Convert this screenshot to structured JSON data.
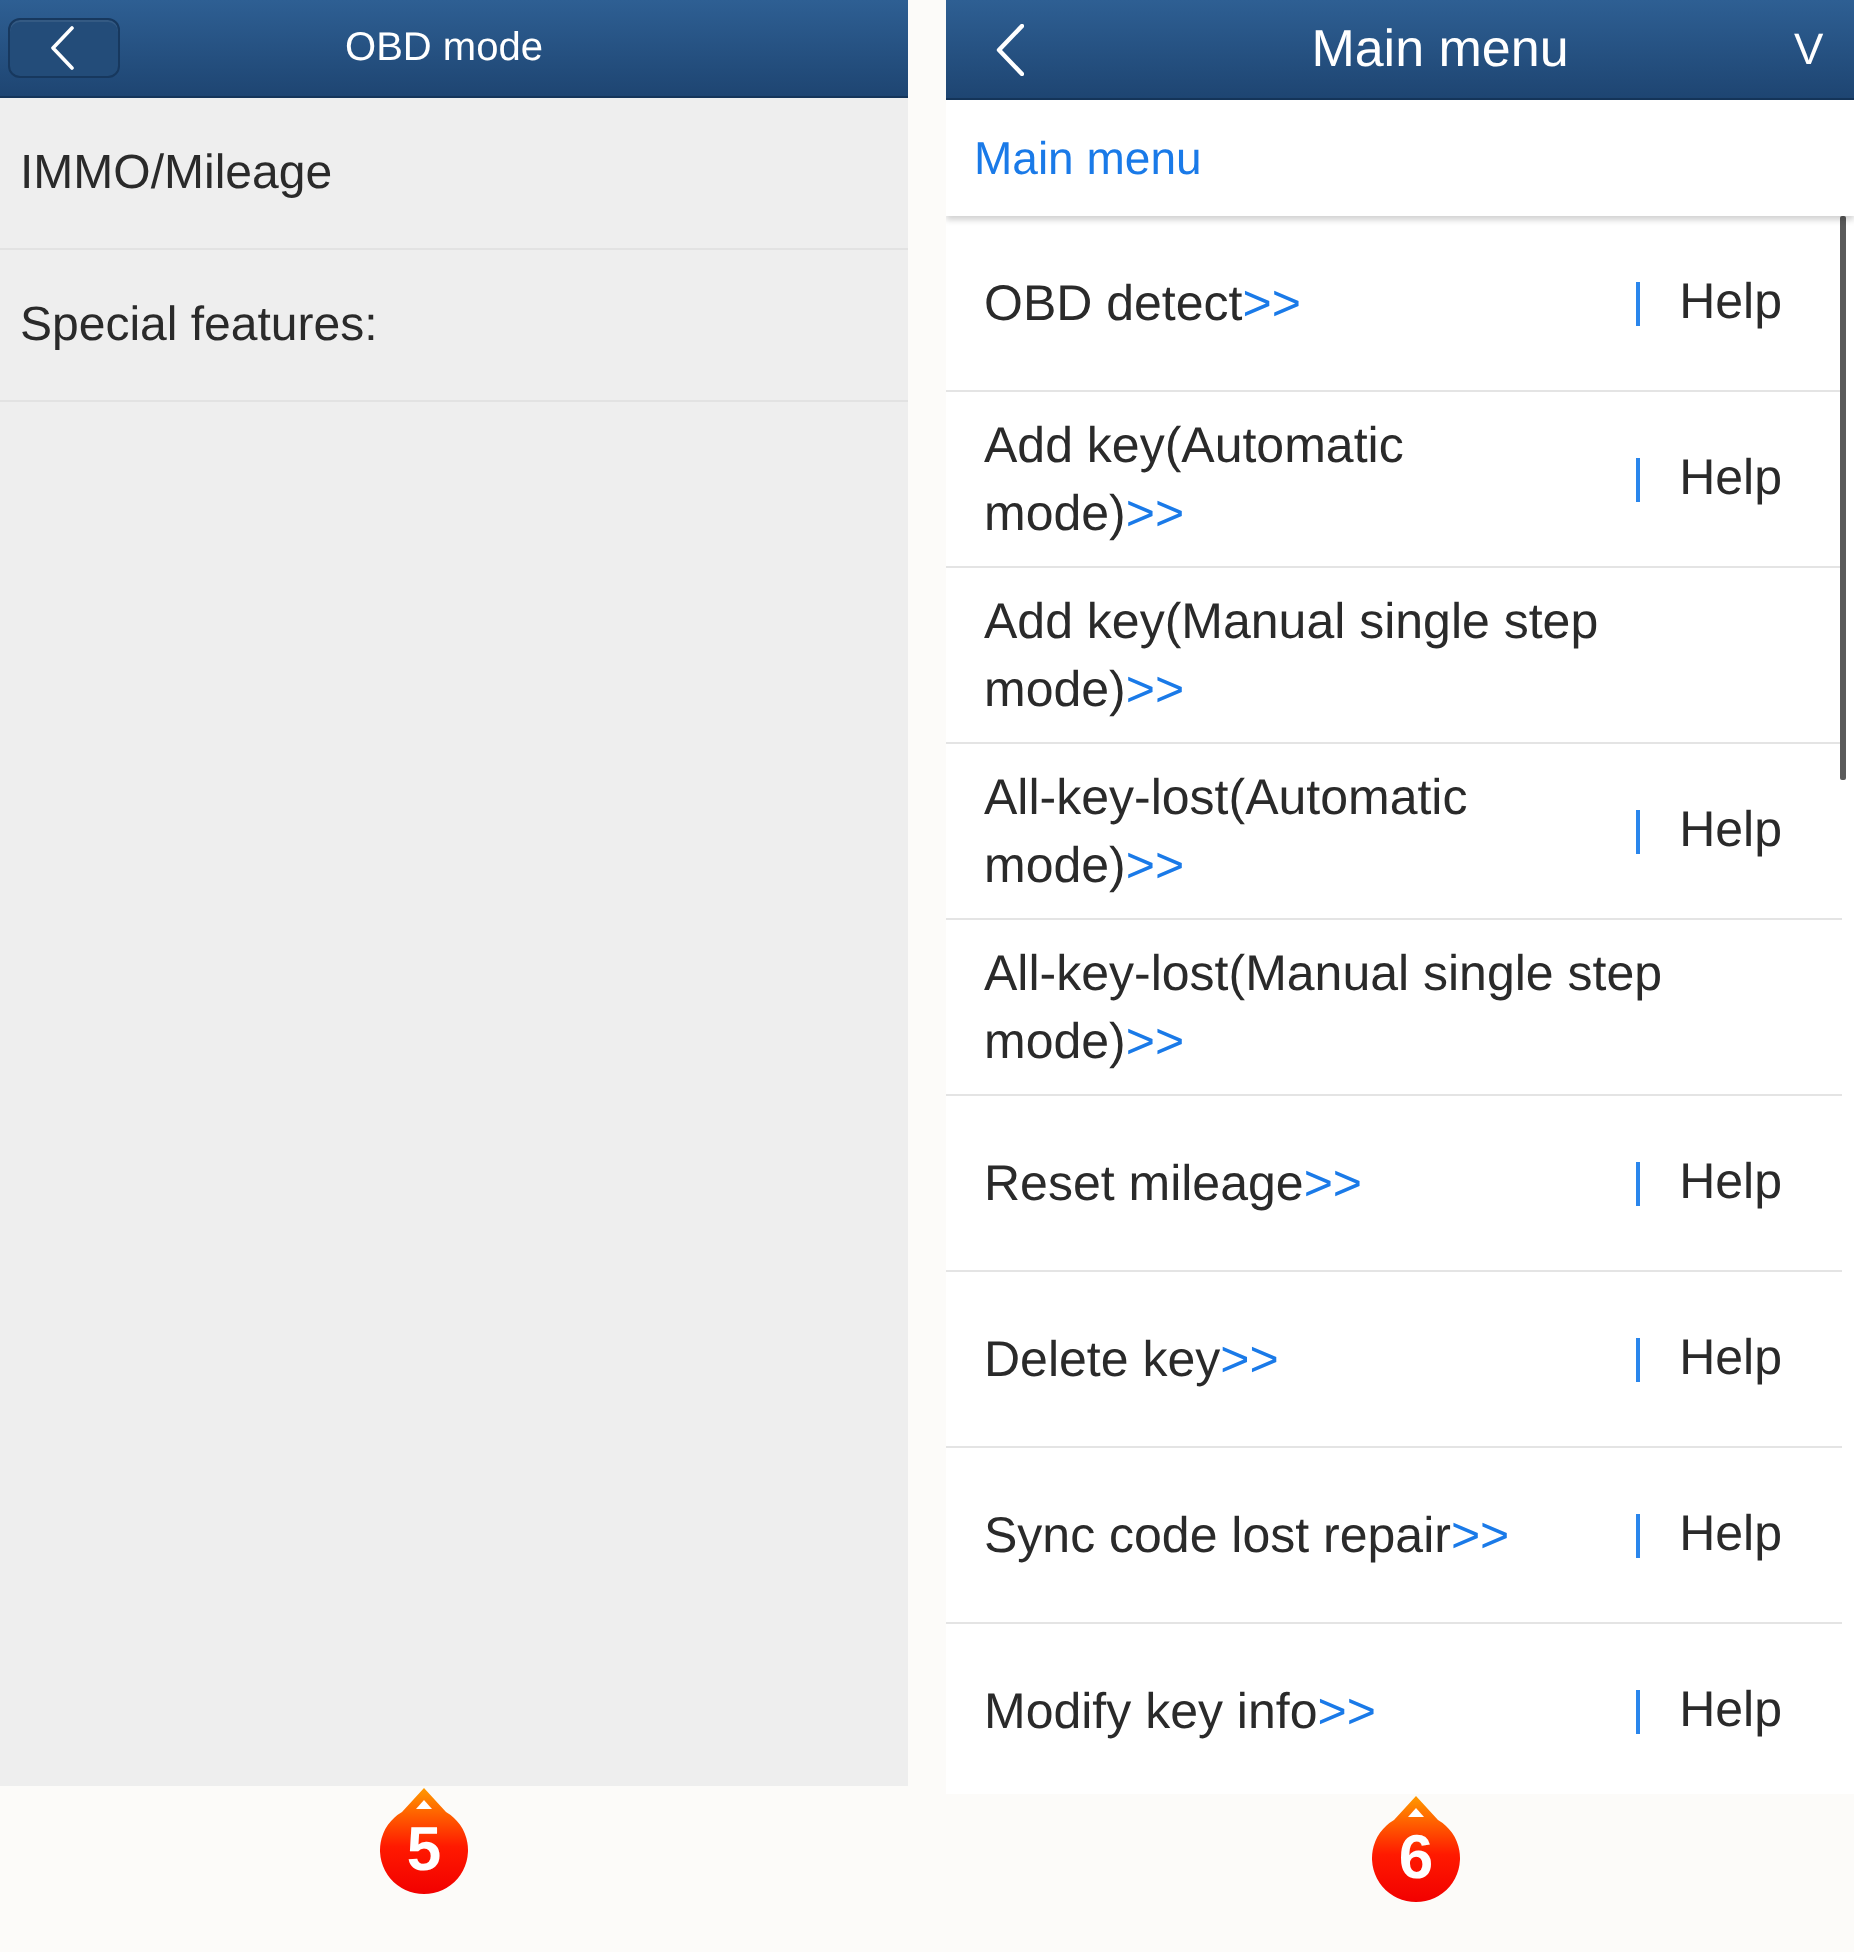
{
  "obd_screen": {
    "header": {
      "title": "OBD mode"
    },
    "items": [
      {
        "label": "IMMO/Mileage"
      },
      {
        "label": "Special features:"
      }
    ],
    "step_badge": "5"
  },
  "menu_screen": {
    "header": {
      "title": "Main menu",
      "trailing": "V"
    },
    "breadcrumb": "Main menu",
    "items": [
      {
        "label": "OBD detect",
        "suffix": ">>",
        "help": "Help"
      },
      {
        "label": "Add key(Automatic mode)",
        "suffix": ">>",
        "help": "Help"
      },
      {
        "label": "Add key(Manual single step mode)",
        "suffix": ">>"
      },
      {
        "label": "All-key-lost(Automatic mode)",
        "suffix": ">>",
        "help": "Help"
      },
      {
        "label": "All-key-lost(Manual single step mode)",
        "suffix": ">>"
      },
      {
        "label": "Reset mileage",
        "suffix": ">>",
        "help": "Help"
      },
      {
        "label": "Delete key",
        "suffix": ">>",
        "help": "Help"
      },
      {
        "label": "Sync code lost repair",
        "suffix": ">>",
        "help": "Help"
      },
      {
        "label": "Modify key info",
        "suffix": ">>",
        "help": "Help"
      }
    ],
    "step_badge": "6"
  }
}
